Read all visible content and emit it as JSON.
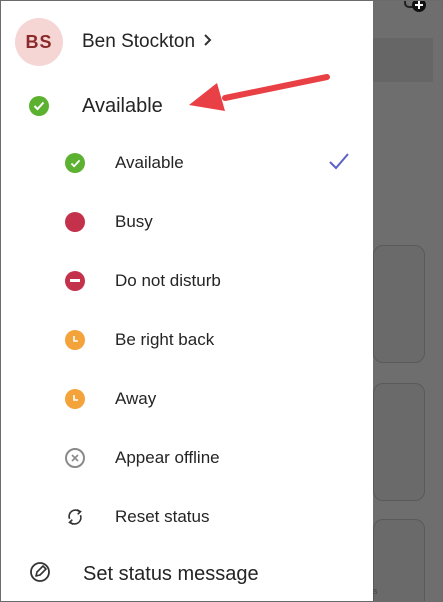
{
  "profile": {
    "initials": "BS",
    "name": "Ben Stockton"
  },
  "current_status": {
    "label": "Available"
  },
  "status_options": [
    {
      "label": "Available",
      "icon": "available-check-icon",
      "selected": true
    },
    {
      "label": "Busy",
      "icon": "busy-dot-icon"
    },
    {
      "label": "Do not disturb",
      "icon": "do-not-disturb-icon"
    },
    {
      "label": "Be right back",
      "icon": "clock-icon"
    },
    {
      "label": "Away",
      "icon": "clock-icon"
    },
    {
      "label": "Appear offline",
      "icon": "offline-x-icon"
    },
    {
      "label": "Reset status",
      "icon": "reset-arrows-icon"
    }
  ],
  "set_status_message": {
    "label": "Set status message"
  },
  "colors": {
    "available": "#5db130",
    "busy": "#c4314b",
    "away": "#f4a23a",
    "offline": "#8a8a8a",
    "check": "#5b5fc7",
    "annotation_arrow": "#e84045"
  }
}
